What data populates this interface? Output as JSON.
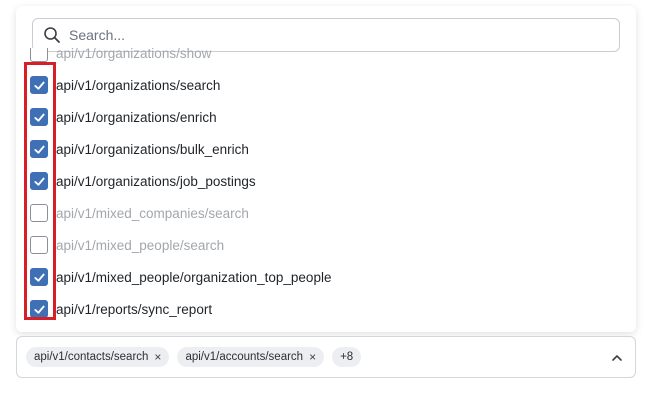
{
  "search": {
    "placeholder": "Search..."
  },
  "list": {
    "items": [
      {
        "label": "api/v1/organizations/show",
        "checked": false,
        "disabled": true
      },
      {
        "label": "api/v1/organizations/search",
        "checked": true,
        "disabled": false
      },
      {
        "label": "api/v1/organizations/enrich",
        "checked": true,
        "disabled": false
      },
      {
        "label": "api/v1/organizations/bulk_enrich",
        "checked": true,
        "disabled": false
      },
      {
        "label": "api/v1/organizations/job_postings",
        "checked": true,
        "disabled": false
      },
      {
        "label": "api/v1/mixed_companies/search",
        "checked": false,
        "disabled": true
      },
      {
        "label": "api/v1/mixed_people/search",
        "checked": false,
        "disabled": true
      },
      {
        "label": "api/v1/mixed_people/organization_top_people",
        "checked": true,
        "disabled": false
      },
      {
        "label": "api/v1/reports/sync_report",
        "checked": true,
        "disabled": false
      }
    ]
  },
  "selected": {
    "tags": [
      {
        "label": "api/v1/contacts/search",
        "remove": "×"
      },
      {
        "label": "api/v1/accounts/search",
        "remove": "×"
      }
    ],
    "more_count": "+8"
  },
  "colors": {
    "checkbox_checked": "#3f6fb5",
    "highlight": "#d61f26"
  },
  "icons": {
    "search": "search-icon",
    "check": "check-icon",
    "expand": "chevron-up-icon"
  }
}
